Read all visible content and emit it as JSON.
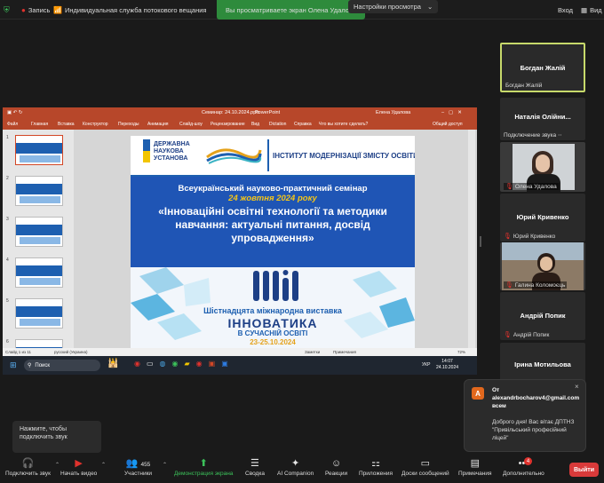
{
  "topbar": {
    "record_label": "Запись",
    "stream_label": "Индивидуальная служба потокового вещания",
    "viewing_banner": "Вы просматриваете экран Олена Удалова",
    "view_settings": "Настройки просмотра",
    "signin": "Вход",
    "view": "Вид"
  },
  "powerpoint": {
    "filename": "Семинар: 24.10.2024.pptx",
    "app": "PowerPoint",
    "user": "Елена Удалова",
    "tabs": [
      "Файл",
      "Главная",
      "Вставка",
      "Конструктор",
      "Переходы",
      "Анимация",
      "Слайд-шоу",
      "Рецензирование",
      "Вид",
      "Dictation",
      "Справка",
      "Что вы хотите сделать?"
    ],
    "share": "Общий доступ",
    "thumb_numbers": [
      "1",
      "2",
      "3",
      "4",
      "5",
      "6"
    ],
    "status_left": "Слайд 1 из 11",
    "status_lang": "русский (Украина)",
    "status_notes": "Заметки",
    "status_comments": "Примечания",
    "status_zoom": "72%"
  },
  "slide": {
    "logo1_line1": "ДЕРЖАВНА",
    "logo1_line2": "НАУКОВА",
    "logo1_line3": "УСТАНОВА",
    "institute": "ІНСТИТУТ МОДЕРНІЗАЦІЇ ЗМІСТУ ОСВІТИ",
    "line1": "Всеукраїнський науково-практичний семінар",
    "line2": "24 жовтня 2024 року",
    "title": "«Інноваційні освітні технології та методики навчання: актуальні питання, досвід упровадження»",
    "expo_line": "Шістнадцята міжнародна виставка",
    "expo_name": "ІННОВАТИКА",
    "expo_sub": "В СУЧАСНІЙ ОСВІТІ",
    "expo_dates": "23-25.10.2024"
  },
  "taskbar": {
    "search": "Поиск",
    "lang": "УКР",
    "time": "14:07",
    "date": "24.10.2024"
  },
  "participants": [
    {
      "name": "Богдан Жалій",
      "label": "Богдан Жалій"
    },
    {
      "name": "Наталія Олійни...",
      "label": "Подключение звука"
    },
    {
      "name": "",
      "label": "Олена Удалова"
    },
    {
      "name": "Юрий Кривенко",
      "label": "Юрий Кривенко"
    },
    {
      "name": "",
      "label": "Галина Коломоєць"
    },
    {
      "name": "Андрій Попик",
      "label": "Андрій Попик"
    },
    {
      "name": "Ірина Мотильова",
      "label": ""
    }
  ],
  "chat": {
    "avatar": "A",
    "from_prefix": "От",
    "from": "alexandrbocharov4@gmail.com всем",
    "message": "Доброго дня! Вас вітає ДПТНЗ \"Привільський професійний ліцей\""
  },
  "audio_tip": "Нажмите, чтобы подключить звук",
  "toolbar": {
    "audio": "Подключить звук",
    "video": "Начать видео",
    "participants": "Участники",
    "participants_count": "455",
    "share": "Демонстрация экрана",
    "summary": "Сводка",
    "ai": "AI Companion",
    "reactions": "Реакции",
    "apps": "Приложения",
    "whiteboards": "Доски сообщений",
    "notes": "Примечания",
    "more": "Дополнительно",
    "more_badge": "4",
    "leave": "Выйти"
  }
}
